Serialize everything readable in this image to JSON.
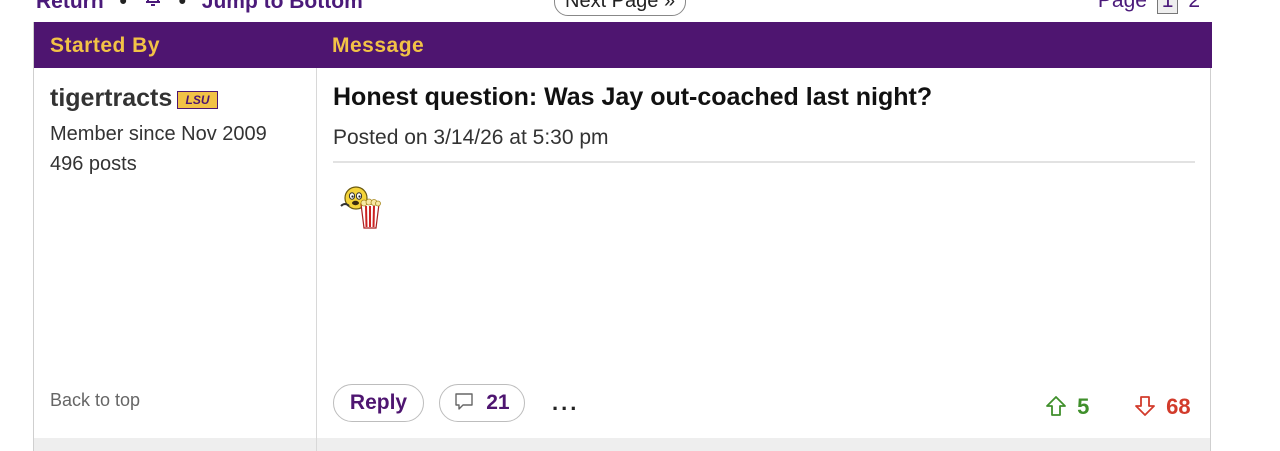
{
  "topnav": {
    "return_label": "Return",
    "jump_label": "Jump to Bottom",
    "next_label": "Next Page »",
    "page_label": "Page",
    "current_page": "1",
    "next_page_num": "2"
  },
  "table": {
    "col_started_by": "Started By",
    "col_message": "Message"
  },
  "author": {
    "username": "tigertracts",
    "flair_text": "LSU",
    "member_since": "Member since Nov 2009",
    "posts": "496 posts",
    "back_to_top": "Back to top"
  },
  "post": {
    "title": "Honest question: Was Jay out-coached last night?",
    "posted": "Posted on 3/14/26 at 5:30 pm",
    "emoji_icon": "popcorn-smiley-icon"
  },
  "actions": {
    "reply_label": "Reply",
    "comments_count": "21",
    "more_label": "...",
    "upvotes": "5",
    "downvotes": "68"
  },
  "colors": {
    "header_bg": "#4e1570",
    "header_text": "#f2c246",
    "upvote": "#3f8f2b",
    "downvote": "#d23b2b"
  }
}
